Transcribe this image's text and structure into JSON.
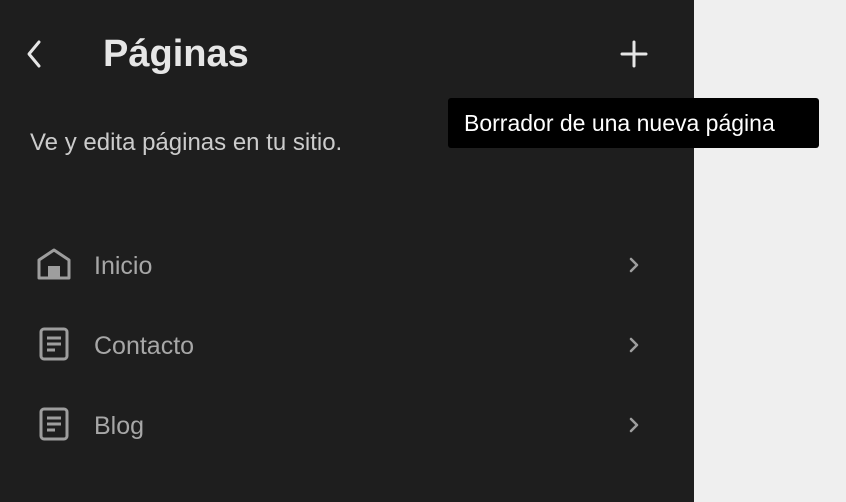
{
  "header": {
    "title": "Páginas",
    "back_icon": "chevron-left-icon",
    "add_icon": "plus-icon"
  },
  "description": "Ve y edita páginas en tu sitio.",
  "tooltip": "Borrador de una nueva página",
  "pages": [
    {
      "label": "Inicio",
      "icon": "home-icon"
    },
    {
      "label": "Contacto",
      "icon": "page-icon"
    },
    {
      "label": "Blog",
      "icon": "page-icon"
    }
  ],
  "colors": {
    "sidebar_bg": "#1e1e1e",
    "canvas_bg": "#efefef",
    "tooltip_bg": "#000000",
    "text_primary": "#e6e6e6",
    "text_muted": "#a7a7a7"
  }
}
